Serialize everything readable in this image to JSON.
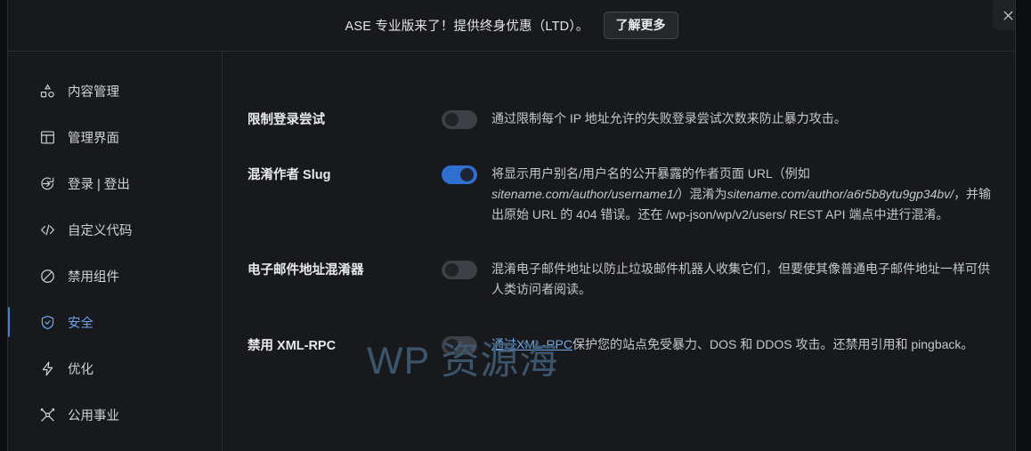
{
  "banner": {
    "text": "ASE 专业版来了！提供终身优惠（LTD）。",
    "button_label": "了解更多",
    "close_icon": "close-icon"
  },
  "sidebar": {
    "items": [
      {
        "label": "内容管理",
        "icon": "shapes-icon",
        "active": false
      },
      {
        "label": "管理界面",
        "icon": "layout-panel-icon",
        "active": false
      },
      {
        "label": "登录 | 登出",
        "icon": "login-arrow-icon",
        "active": false
      },
      {
        "label": "自定义代码",
        "icon": "code-brackets-icon",
        "active": false
      },
      {
        "label": "禁用组件",
        "icon": "ban-circle-icon",
        "active": false
      },
      {
        "label": "安全",
        "icon": "shield-check-icon",
        "active": true
      },
      {
        "label": "优化",
        "icon": "lightning-bolt-icon",
        "active": false
      },
      {
        "label": "公用事业",
        "icon": "tools-icon",
        "active": false
      }
    ]
  },
  "settings": {
    "rows": [
      {
        "label": "限制登录尝试",
        "toggle_state": "off",
        "description_parts": [
          {
            "type": "text",
            "text": "通过限制每个 IP 地址允许的失败登录尝试次数来防止暴力攻击。"
          }
        ]
      },
      {
        "label": "混淆作者 Slug",
        "toggle_state": "on",
        "description_parts": [
          {
            "type": "text",
            "text": "将显示用户别名/用户名的公开暴露的作者页面 URL（例如 "
          },
          {
            "type": "italic",
            "text": "sitename.com/author/username1/"
          },
          {
            "type": "text",
            "text": "）混淆为"
          },
          {
            "type": "italic",
            "text": "sitename.com/author/a6r5b8ytu9gp34bv/"
          },
          {
            "type": "text",
            "text": "，并输出原始 URL 的 404 错误。还在 /wp-json/wp/v2/users/ REST API 端点中进行混淆。"
          }
        ]
      },
      {
        "label": "电子邮件地址混淆器",
        "toggle_state": "off",
        "description_parts": [
          {
            "type": "text",
            "text": "混淆电子邮件地址以防止垃圾邮件机器人收集它们，但要使其像普通电子邮件地址一样可供人类访问者阅读。"
          }
        ]
      },
      {
        "label": "禁用 XML-RPC",
        "toggle_state": "off",
        "description_parts": [
          {
            "type": "link",
            "text": "通过XML-RPC"
          },
          {
            "type": "text",
            "text": "保护您的站点免受暴力、DOS 和 DDOS 攻击。还禁用引用和 pingback。"
          }
        ]
      }
    ]
  },
  "watermark": {
    "text": "WP 资源海"
  },
  "colors": {
    "accent": "#3b82d6",
    "toggle_on": "#2f6fd0",
    "toggle_off": "#3d4046",
    "link": "#6fa8e8",
    "background": "#18191c",
    "watermark": "#3f5c73"
  }
}
